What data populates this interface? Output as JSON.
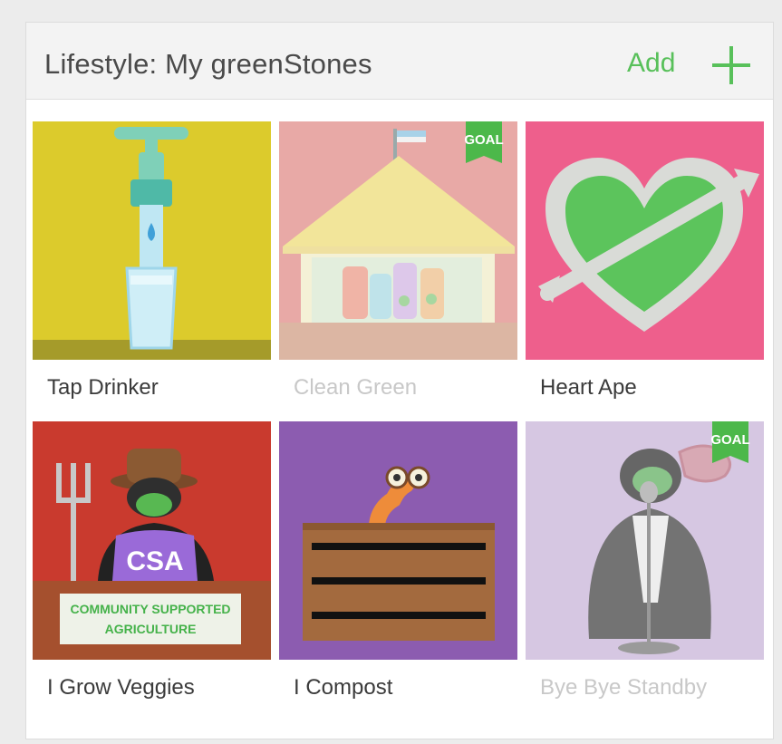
{
  "header": {
    "title": "Lifestyle: My greenStones",
    "add_label": "Add"
  },
  "tiles": [
    {
      "label": "Tap Drinker",
      "dim": false,
      "goal": false,
      "icon": "tap-water-glass-icon",
      "bg": "#dccb2c"
    },
    {
      "label": "Clean Green",
      "dim": true,
      "goal": true,
      "goal_label": "GOAL",
      "icon": "cleaning-products-tent-icon",
      "bg": "#e8a9a6"
    },
    {
      "label": "Heart Ape",
      "dim": false,
      "goal": false,
      "icon": "heart-arrow-icon",
      "bg": "#ee5f8c"
    },
    {
      "label": "I Grow Veggies",
      "dim": false,
      "goal": false,
      "icon": "gorilla-farmer-icon",
      "bg": "#c93a2e",
      "shirt_text": "CSA",
      "sign_text": "COMMUNITY SUPPORTED AGRICULTURE",
      "sign_line1": "COMMUNITY SUPPORTED",
      "sign_line2": "AGRICULTURE"
    },
    {
      "label": "I Compost",
      "dim": false,
      "goal": false,
      "icon": "worm-compost-crate-icon",
      "bg": "#8c5cb0"
    },
    {
      "label": "Bye Bye Standby",
      "dim": true,
      "goal": true,
      "goal_label": "GOAL",
      "icon": "gorilla-microphone-icon",
      "bg": "#d6c7e2"
    }
  ]
}
